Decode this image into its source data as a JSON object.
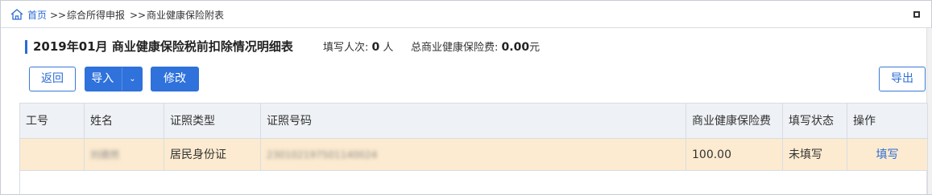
{
  "breadcrumb": {
    "home": "首页",
    "sep1": ">>",
    "level2": "综合所得申报",
    "sep2": ">>",
    "level3": "商业健康保险附表"
  },
  "header": {
    "title": "2019年01月 商业健康保险税前扣除情况明细表",
    "count_label": "填写人次:",
    "count_value": "0",
    "count_unit": "人",
    "total_label": "总商业健康保险费:",
    "total_value": "0.00",
    "total_unit": "元",
    "accent_color": "#2b6cd4"
  },
  "toolbar": {
    "back_label": "返回",
    "import_label": "导入",
    "edit_label": "修改",
    "export_label": "导出"
  },
  "table": {
    "columns": [
      "工号",
      "姓名",
      "证照类型",
      "证照号码",
      "商业健康保险费",
      "填写状态",
      "操作"
    ],
    "rows": [
      {
        "employee_id": "",
        "name": "刘德然",
        "id_type": "居民身份证",
        "id_number": "230102197501140024",
        "premium": "100.00",
        "status": "未填写",
        "action": "填写"
      }
    ],
    "selected_row_color": "#fcebd0"
  }
}
